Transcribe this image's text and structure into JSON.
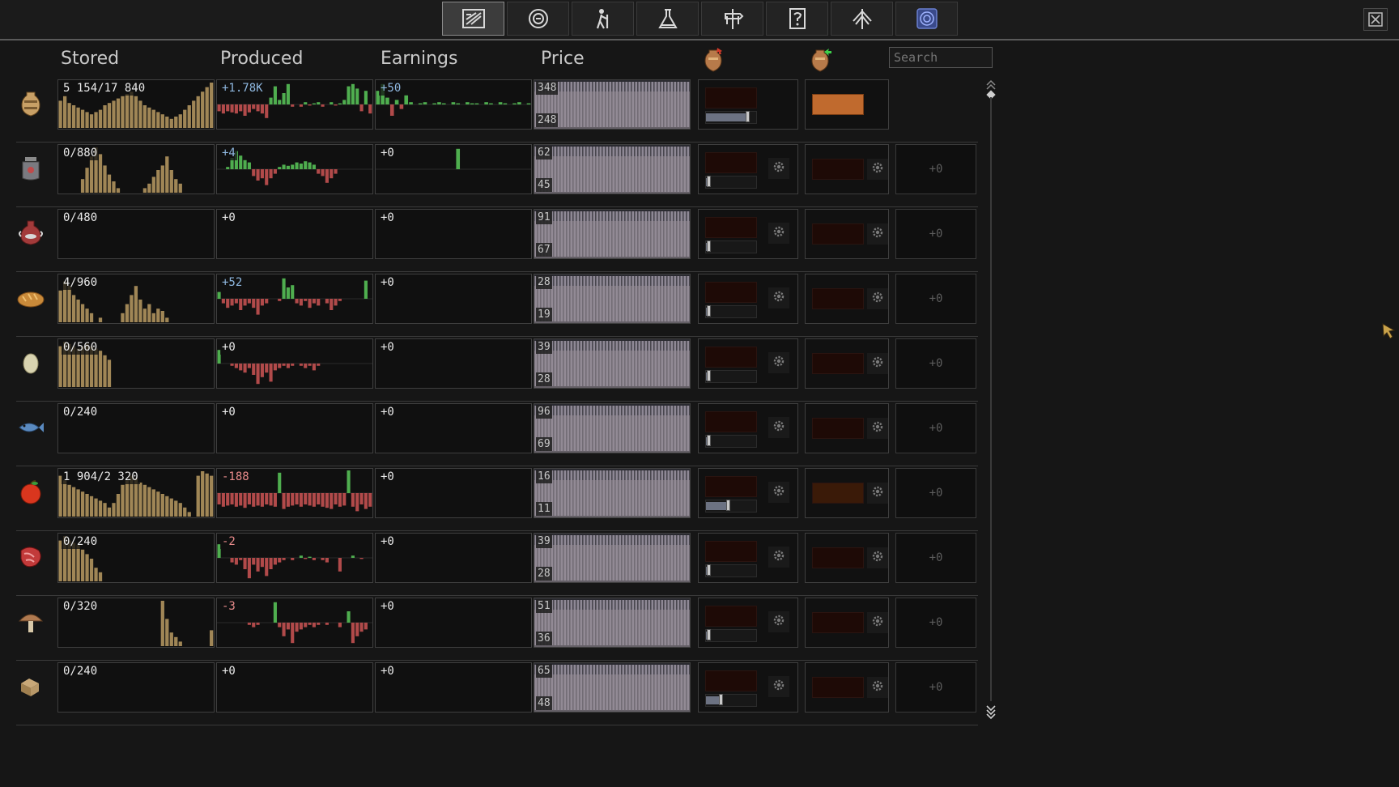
{
  "tabs": [
    {
      "name": "ledger",
      "icon": "ledger-icon",
      "active": true
    },
    {
      "name": "coin",
      "icon": "coin-icon"
    },
    {
      "name": "workers",
      "icon": "worker-icon"
    },
    {
      "name": "research",
      "icon": "flask-icon"
    },
    {
      "name": "roads",
      "icon": "signpost-icon"
    },
    {
      "name": "help",
      "icon": "question-icon"
    },
    {
      "name": "tree",
      "icon": "tree-icon"
    },
    {
      "name": "map",
      "icon": "map-icon"
    }
  ],
  "headers": {
    "stored": "Stored",
    "produced": "Produced",
    "earnings": "Earnings",
    "price": "Price",
    "import_icon": "import-amphora-icon",
    "export_icon": "export-amphora-icon"
  },
  "search": {
    "placeholder": "Search"
  },
  "rows": [
    {
      "icon": "amphora-icon",
      "stored": "5 154/17 840",
      "produced": "+1.78K",
      "earnings": "+50",
      "price_hi": "348",
      "price_lo": "248",
      "delta": "",
      "buy_slider": 0.85,
      "sell_active": true,
      "stored_series": [
        0.6,
        0.7,
        0.55,
        0.5,
        0.45,
        0.4,
        0.35,
        0.3,
        0.35,
        0.4,
        0.5,
        0.55,
        0.6,
        0.65,
        0.7,
        0.75,
        0.8,
        0.7,
        0.6,
        0.5,
        0.45,
        0.4,
        0.35,
        0.3,
        0.25,
        0.2,
        0.25,
        0.3,
        0.4,
        0.5,
        0.6,
        0.7,
        0.8,
        0.9,
        1.0
      ],
      "produced_series": [
        -0.3,
        -0.4,
        -0.3,
        -0.35,
        -0.4,
        -0.3,
        -0.5,
        -0.35,
        -0.2,
        -0.3,
        -0.4,
        -0.6,
        0.3,
        0.8,
        0.2,
        0.5,
        0.9,
        -0.1,
        0,
        -0.1,
        0.1,
        -0.05,
        0.05,
        0.1,
        -0.1,
        0,
        0.1,
        -0.05,
        0.05,
        0.2,
        0.8,
        0.9,
        0.7,
        -0.3,
        0.6,
        -0.4
      ],
      "earnings_series": [
        0.6,
        0.9,
        0.3,
        -0.5,
        0.2,
        -0.2,
        0.4,
        0.1,
        0,
        0.05,
        0.1,
        0,
        0.05,
        0.1,
        0.05,
        0,
        0.1,
        0.05,
        0,
        0.1,
        0.05,
        0.05,
        0,
        0.1,
        0.05,
        0,
        0.1,
        0.05,
        0,
        0.05,
        0.1,
        0,
        0.05
      ]
    },
    {
      "icon": "jar-icon",
      "stored": "0/880",
      "produced": "+4",
      "earnings": "+0",
      "price_hi": "62",
      "price_lo": "45",
      "delta": "+0",
      "buy_slider": 0.05,
      "stored_series": [
        0,
        0,
        0,
        0,
        0,
        0.3,
        0.55,
        0.8,
        1.0,
        0.85,
        0.6,
        0.4,
        0.25,
        0.1,
        0,
        0,
        0,
        0,
        0,
        0.1,
        0.2,
        0.35,
        0.5,
        0.6,
        0.8,
        0.5,
        0.3,
        0.2,
        0,
        0,
        0,
        0,
        0,
        0,
        0
      ],
      "produced_series": [
        0,
        0,
        0.1,
        0.5,
        0.8,
        0.6,
        0.4,
        0.3,
        -0.3,
        -0.5,
        -0.4,
        -0.7,
        -0.4,
        -0.2,
        0.1,
        0.2,
        0.15,
        0.2,
        0.3,
        0.25,
        0.35,
        0.3,
        0.2,
        -0.2,
        -0.3,
        -0.6,
        -0.4,
        -0.2,
        0,
        0,
        0,
        0,
        0,
        0,
        0,
        0
      ],
      "earnings_series": [
        0,
        0,
        0,
        0,
        0,
        0,
        0,
        0,
        0,
        0,
        0,
        0,
        0,
        0,
        0,
        0,
        0,
        0.9,
        0,
        0,
        0,
        0,
        0,
        0,
        0,
        0,
        0,
        0,
        0,
        0,
        0,
        0,
        0
      ]
    },
    {
      "icon": "vase-icon",
      "stored": "0/480",
      "produced": "+0",
      "earnings": "+0",
      "price_hi": "91",
      "price_lo": "67",
      "delta": "+0",
      "buy_slider": 0.05,
      "stored_series": [],
      "produced_series": [],
      "earnings_series": []
    },
    {
      "icon": "bread-icon",
      "stored": "4/960",
      "produced": "+52",
      "earnings": "+0",
      "price_hi": "28",
      "price_lo": "19",
      "delta": "+0",
      "buy_slider": 0.05,
      "stored_series": [
        0.7,
        0.9,
        0.8,
        0.6,
        0.5,
        0.4,
        0.3,
        0.2,
        0,
        0.1,
        0,
        0,
        0,
        0,
        0.2,
        0.4,
        0.6,
        0.8,
        0.5,
        0.3,
        0.4,
        0.2,
        0.3,
        0.25,
        0.1,
        0,
        0,
        0,
        0,
        0,
        0,
        0,
        0,
        0,
        0
      ],
      "produced_series": [
        0.3,
        -0.2,
        -0.4,
        -0.3,
        -0.2,
        -0.5,
        -0.3,
        -0.2,
        -0.4,
        -0.7,
        -0.3,
        -0.2,
        0,
        0,
        -0.1,
        0.9,
        0.5,
        0.6,
        -0.2,
        -0.3,
        -0.1,
        -0.4,
        -0.2,
        -0.3,
        0,
        -0.2,
        -0.5,
        -0.3,
        -0.1,
        0,
        0,
        0,
        0,
        0,
        0.8,
        0
      ],
      "earnings_series": []
    },
    {
      "icon": "egg-icon",
      "stored": "0/560",
      "produced": "+0",
      "earnings": "+0",
      "price_hi": "39",
      "price_lo": "28",
      "delta": "+0",
      "buy_slider": 0.05,
      "stored_series": [
        0.9,
        1.0,
        0.95,
        0.9,
        0.85,
        0.9,
        0.95,
        0.9,
        0.85,
        0.8,
        0.7,
        0.6,
        0,
        0,
        0,
        0,
        0,
        0,
        0,
        0,
        0,
        0,
        0,
        0,
        0,
        0,
        0,
        0,
        0,
        0,
        0,
        0,
        0,
        0,
        0
      ],
      "produced_series": [
        0.6,
        0,
        0,
        -0.1,
        -0.2,
        -0.3,
        -0.4,
        -0.2,
        -0.5,
        -0.9,
        -0.6,
        -0.4,
        -0.8,
        -0.3,
        -0.2,
        -0.1,
        -0.2,
        -0.1,
        0,
        -0.1,
        -0.2,
        -0.1,
        -0.3,
        -0.1,
        0,
        0,
        0,
        0,
        0,
        0,
        0,
        0,
        0,
        0,
        0,
        0
      ],
      "earnings_series": []
    },
    {
      "icon": "fish-icon",
      "stored": "0/240",
      "produced": "+0",
      "earnings": "+0",
      "price_hi": "96",
      "price_lo": "69",
      "delta": "+0",
      "buy_slider": 0.05,
      "stored_series": [],
      "produced_series": [],
      "earnings_series": []
    },
    {
      "icon": "apple-icon",
      "stored": "1 904/2 320",
      "produced": "-188",
      "earnings": "+0",
      "price_hi": "16",
      "price_lo": "11",
      "delta": "+0",
      "buy_slider": 0.45,
      "sell_dim": true,
      "stored_series": [
        0.9,
        0.8,
        0.7,
        0.65,
        0.6,
        0.55,
        0.5,
        0.45,
        0.4,
        0.35,
        0.3,
        0.2,
        0.3,
        0.5,
        0.7,
        0.8,
        0.9,
        0.85,
        0.75,
        0.7,
        0.65,
        0.6,
        0.55,
        0.5,
        0.45,
        0.4,
        0.35,
        0.3,
        0.2,
        0.1,
        0,
        0.9,
        1.0,
        0.95,
        0.9
      ],
      "produced_series": [
        -0.5,
        -0.6,
        -0.55,
        -0.5,
        -0.6,
        -0.55,
        -0.65,
        -0.5,
        -0.6,
        -0.55,
        -0.6,
        -0.5,
        -0.55,
        -0.6,
        0.9,
        -0.7,
        -0.6,
        -0.55,
        -0.5,
        -0.6,
        -0.5,
        -0.55,
        -0.6,
        -0.5,
        -0.6,
        -0.65,
        -0.7,
        -0.5,
        -0.6,
        -0.55,
        1.0,
        -0.6,
        -0.8,
        -0.5,
        -0.7,
        -0.6
      ],
      "earnings_series": []
    },
    {
      "icon": "meat-icon",
      "stored": "0/240",
      "produced": "-2",
      "earnings": "+0",
      "price_hi": "39",
      "price_lo": "28",
      "delta": "+0",
      "buy_slider": 0.05,
      "stored_series": [
        0.9,
        1.0,
        0.9,
        0.85,
        0.8,
        0.7,
        0.6,
        0.5,
        0.3,
        0.2,
        0,
        0,
        0,
        0,
        0,
        0,
        0,
        0,
        0,
        0,
        0,
        0,
        0,
        0,
        0,
        0,
        0,
        0,
        0,
        0,
        0,
        0,
        0,
        0,
        0
      ],
      "produced_series": [
        0.6,
        0,
        0,
        -0.2,
        -0.3,
        -0.1,
        -0.5,
        -0.9,
        -0.3,
        -0.6,
        -0.4,
        -0.8,
        -0.5,
        -0.3,
        -0.2,
        -0.1,
        0,
        -0.1,
        0,
        0.1,
        -0.05,
        0.05,
        -0.1,
        0,
        -0.1,
        -0.2,
        0,
        0,
        -0.6,
        0,
        0,
        0.1,
        0,
        -0.05,
        0,
        0
      ],
      "earnings_series": []
    },
    {
      "icon": "mushroom-icon",
      "stored": "0/320",
      "produced": "-3",
      "earnings": "+0",
      "price_hi": "51",
      "price_lo": "36",
      "delta": "+0",
      "buy_slider": 0.05,
      "stored_series": [
        0,
        0,
        0,
        0,
        0,
        0,
        0,
        0,
        0,
        0,
        0,
        0,
        0,
        0,
        0,
        0,
        0,
        0,
        0,
        0,
        0,
        0,
        0,
        1.0,
        0.6,
        0.3,
        0.2,
        0.1,
        0,
        0,
        0,
        0,
        0,
        0,
        0.35
      ],
      "produced_series": [
        0,
        0,
        0,
        0,
        0,
        0,
        0,
        -0.1,
        -0.2,
        -0.1,
        0,
        0,
        0,
        0.9,
        -0.2,
        -0.6,
        -0.3,
        -0.9,
        -0.4,
        -0.3,
        -0.2,
        -0.1,
        -0.2,
        -0.1,
        0,
        -0.1,
        0,
        0,
        -0.2,
        0,
        0.5,
        -0.9,
        -0.6,
        -0.4,
        -0.3,
        0
      ],
      "earnings_series": []
    },
    {
      "icon": "crate-icon",
      "stored": "0/240",
      "produced": "+0",
      "earnings": "+0",
      "price_hi": "65",
      "price_lo": "48",
      "delta": "+0",
      "buy_slider": 0.3,
      "stored_series": [],
      "produced_series": [],
      "earnings_series": []
    }
  ],
  "colors": {
    "stored": "#a08656",
    "produced_pos": "#4fae4f",
    "produced_neg": "#b14a4a",
    "earnings_pos": "#4fae4f",
    "earnings_neg": "#b14a4a",
    "price_bar": "#8e8895",
    "price_bg": "#2a2a30"
  }
}
